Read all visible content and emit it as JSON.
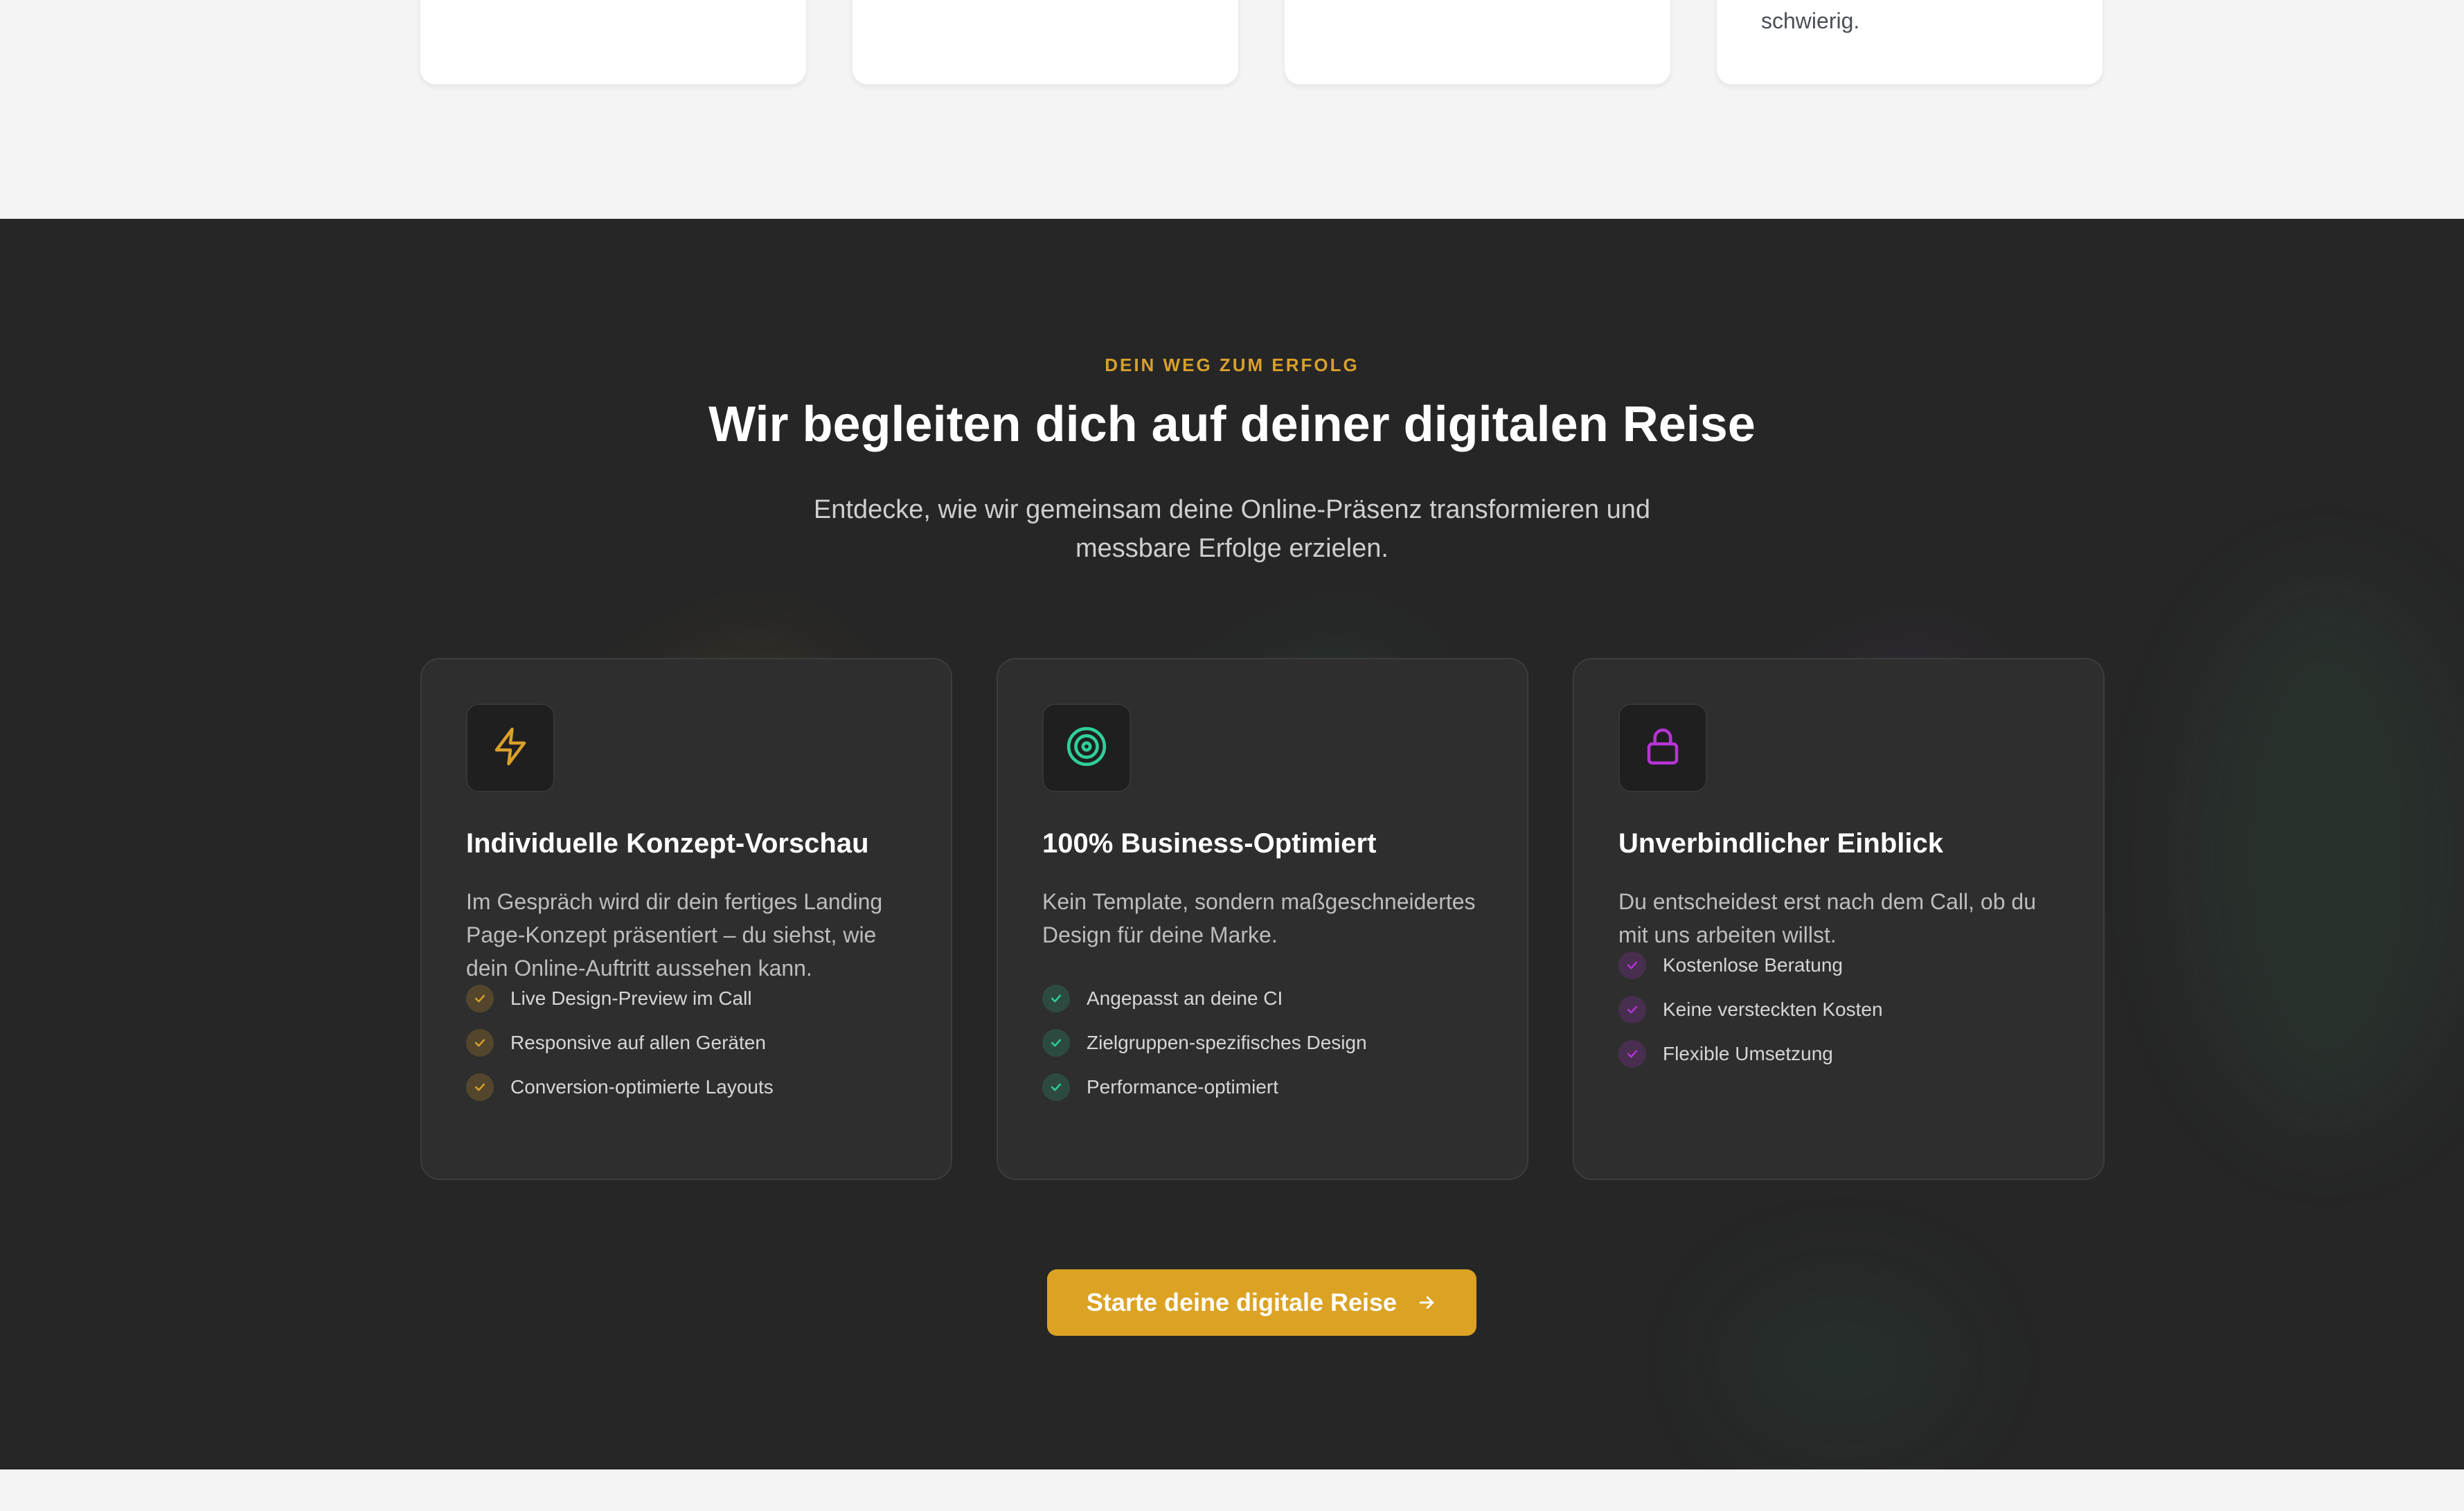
{
  "top_cards": {
    "card4_text": "schwierig."
  },
  "journey": {
    "eyebrow": "DEIN WEG ZUM ERFOLG",
    "headline": "Wir begleiten dich auf deiner digitalen Reise",
    "subline": "Entdecke, wie wir gemeinsam deine Online-Präsenz transformieren und messbare Erfolge erzielen.",
    "cards": [
      {
        "icon": "lightning-icon",
        "accent": "#d9a02a",
        "title": "Individuelle Konzept-Vorschau",
        "description": "Im Gespräch wird dir dein fertiges Landing Page-Konzept präsentiert – du siehst, wie dein Online-Auftritt aussehen kann.",
        "features": [
          "Live Design-Preview im Call",
          "Responsive auf allen Geräten",
          "Conversion-optimierte Layouts"
        ]
      },
      {
        "icon": "target-icon",
        "accent": "#2fcf9a",
        "title": "100% Business-Optimiert",
        "description": "Kein Template, sondern maßgeschneidertes Design für deine Marke.",
        "features": [
          "Angepasst an deine CI",
          "Zielgruppen-spezifisches Design",
          "Performance-optimiert"
        ]
      },
      {
        "icon": "lock-icon",
        "accent": "#b634d6",
        "title": "Unverbindlicher Einblick",
        "description": "Du entscheidest erst nach dem Call, ob du mit uns arbeiten willst.",
        "features": [
          "Kostenlose Beratung",
          "Keine versteckten Kosten",
          "Flexible Umsetzung"
        ]
      }
    ],
    "cta_label": "Starte deine digitale Reise"
  }
}
